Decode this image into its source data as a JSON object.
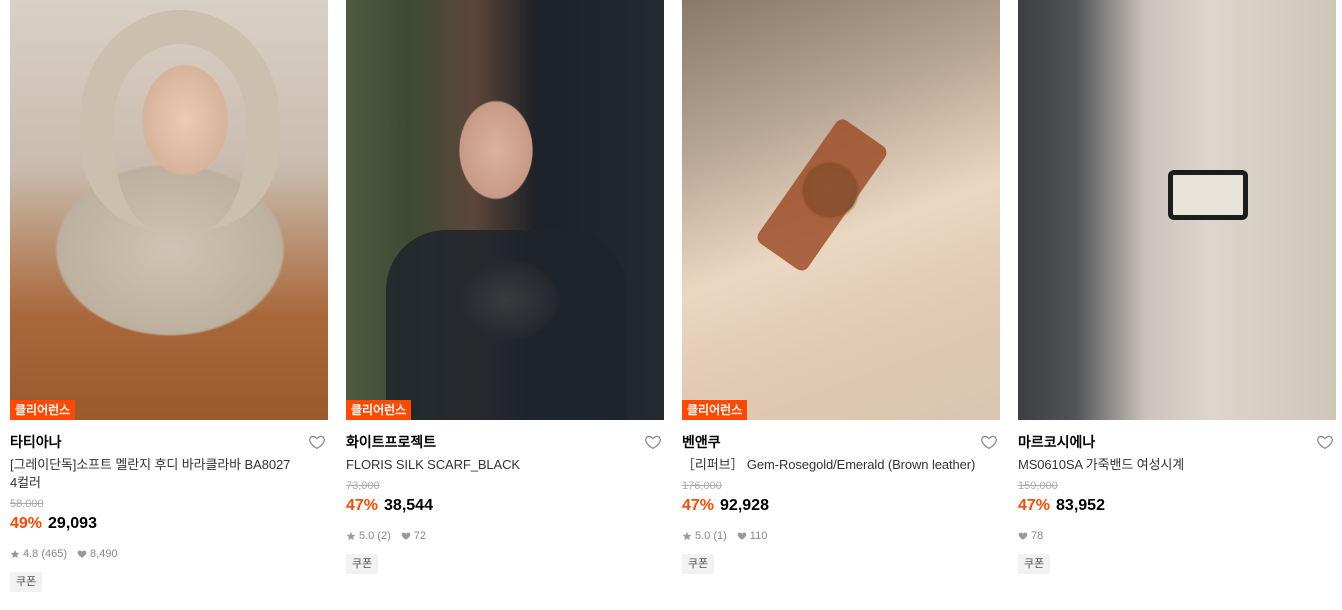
{
  "products": [
    {
      "badge": "클리어런스",
      "brand": "타티아나",
      "title_line1": "[그레이단독]소프트 멜란지 후디 바라클라바 BA8027",
      "title_line2": "4컬러",
      "original_price": "58,000",
      "discount": "49%",
      "price": "29,093",
      "rating": "4.8 (465)",
      "likes": "8,490",
      "coupon": "쿠폰"
    },
    {
      "badge": "클리어런스",
      "brand": "화이트프로젝트",
      "title_line1": "FLORIS SILK SCARF_BLACK",
      "title_line2": "",
      "original_price": "73,000",
      "discount": "47%",
      "price": "38,544",
      "rating": "5.0 (2)",
      "likes": "72",
      "coupon": "쿠폰"
    },
    {
      "badge": "클리어런스",
      "brand": "벤앤쿠",
      "title_line1": "［리퍼브］ Gem-Rosegold/Emerald (Brown leather)",
      "title_line2": "",
      "original_price": "176,000",
      "discount": "47%",
      "price": "92,928",
      "rating": "5.0 (1)",
      "likes": "110",
      "coupon": "쿠폰"
    },
    {
      "badge": "",
      "brand": "마르코시에나",
      "title_line1": "MS0610SA 가죽밴드 여성시계",
      "title_line2": "",
      "original_price": "159,000",
      "discount": "47%",
      "price": "83,952",
      "rating": "",
      "likes": "78",
      "coupon": "쿠폰"
    }
  ],
  "colors": {
    "accent": "#ff4800",
    "muted": "#888888"
  },
  "icons": {
    "wishlist": "heart-outline-icon",
    "rating": "star-icon",
    "likes": "heart-filled-icon"
  }
}
